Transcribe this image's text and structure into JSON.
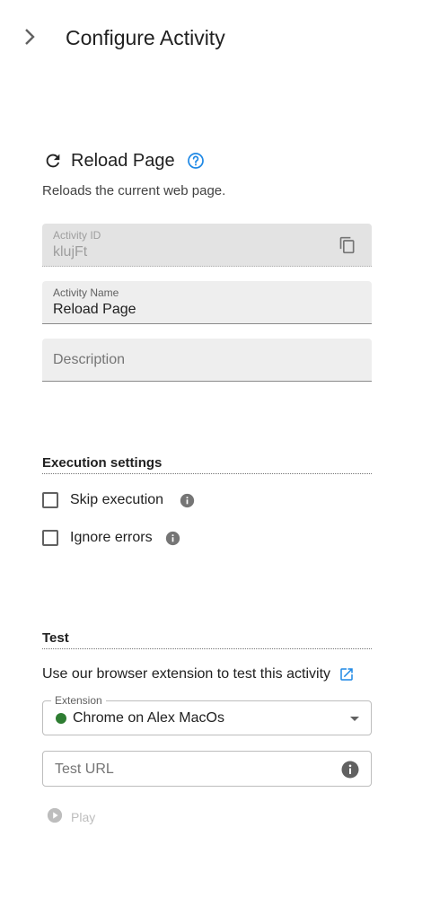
{
  "header": {
    "title": "Configure Activity",
    "collapse_icon": "chevron-right-icon"
  },
  "activity": {
    "title": "Reload Page",
    "icon": "reload-icon",
    "help_icon": "help-circle-icon",
    "description": "Reloads the current web page."
  },
  "fields": {
    "activity_id": {
      "label": "Activity ID",
      "value": "klujFt",
      "copy_icon": "copy-icon"
    },
    "activity_name": {
      "label": "Activity Name",
      "value": "Reload Page"
    },
    "description": {
      "placeholder": "Description"
    }
  },
  "execution": {
    "title": "Execution settings",
    "skip_label": "Skip execution",
    "ignore_label": "Ignore errors"
  },
  "test": {
    "title": "Test",
    "extension_text": "Use our browser extension to test this activity",
    "extension_label": "Extension",
    "extension_value": "Chrome on Alex MacOs",
    "status_color": "#2e7d32",
    "url_placeholder": "Test URL",
    "play_label": "Play"
  },
  "colors": {
    "accent": "#1e88e5",
    "disabled": "#bdbdbd"
  }
}
